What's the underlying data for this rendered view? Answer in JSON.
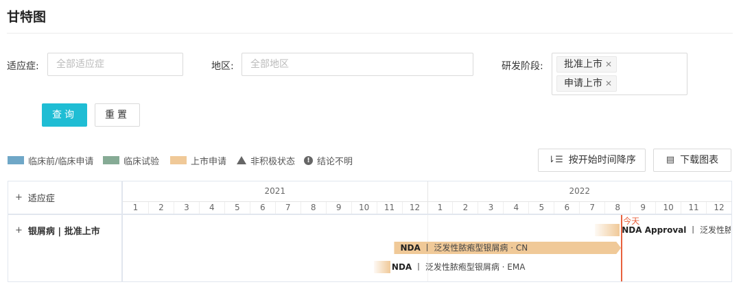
{
  "page": {
    "title": "甘特图"
  },
  "filters": {
    "indication_label": "适应症:",
    "indication_placeholder": "全部适应症",
    "region_label": "地区:",
    "region_placeholder": "全部地区",
    "stage_label": "研发阶段:",
    "stage_tags": [
      "批准上市",
      "申请上市"
    ],
    "query_button": "查询",
    "reset_button": "重置"
  },
  "legend": [
    {
      "label": "临床前/临床申请",
      "color": "#6fa7c7"
    },
    {
      "label": "临床试验",
      "color": "#86ab95"
    },
    {
      "label": "上市申请",
      "color": "#f0c998"
    },
    {
      "label": "非积极状态",
      "icon": "triangle-icon"
    },
    {
      "label": "结论不明",
      "icon": "exclamation-circle-icon"
    }
  ],
  "toolbar": {
    "sort_button": "按开始时间降序",
    "download_button": "下载图表"
  },
  "gantt": {
    "column_header": "适应症",
    "years": [
      "2021",
      "2022"
    ],
    "months": [
      "1",
      "2",
      "3",
      "4",
      "5",
      "6",
      "7",
      "8",
      "9",
      "10",
      "11",
      "12",
      "1",
      "2",
      "3",
      "4",
      "5",
      "6",
      "7",
      "8",
      "9",
      "10",
      "11",
      "12"
    ],
    "today_label": "今天",
    "row_label": "银屑病 | 批准上市",
    "bars": [
      {
        "type": "NDA Approval",
        "sep": "丨",
        "desc": "泛发性脓",
        "region": ""
      },
      {
        "type": "NDA",
        "sep": "丨",
        "desc": "泛发性脓疱型银屑病",
        "dot": "·",
        "region": "CN"
      },
      {
        "type": "NDA",
        "sep": "丨",
        "desc": "泛发性脓疱型银屑病",
        "dot": "·",
        "region": "EMA"
      }
    ],
    "bar_color": "#f0c998"
  }
}
